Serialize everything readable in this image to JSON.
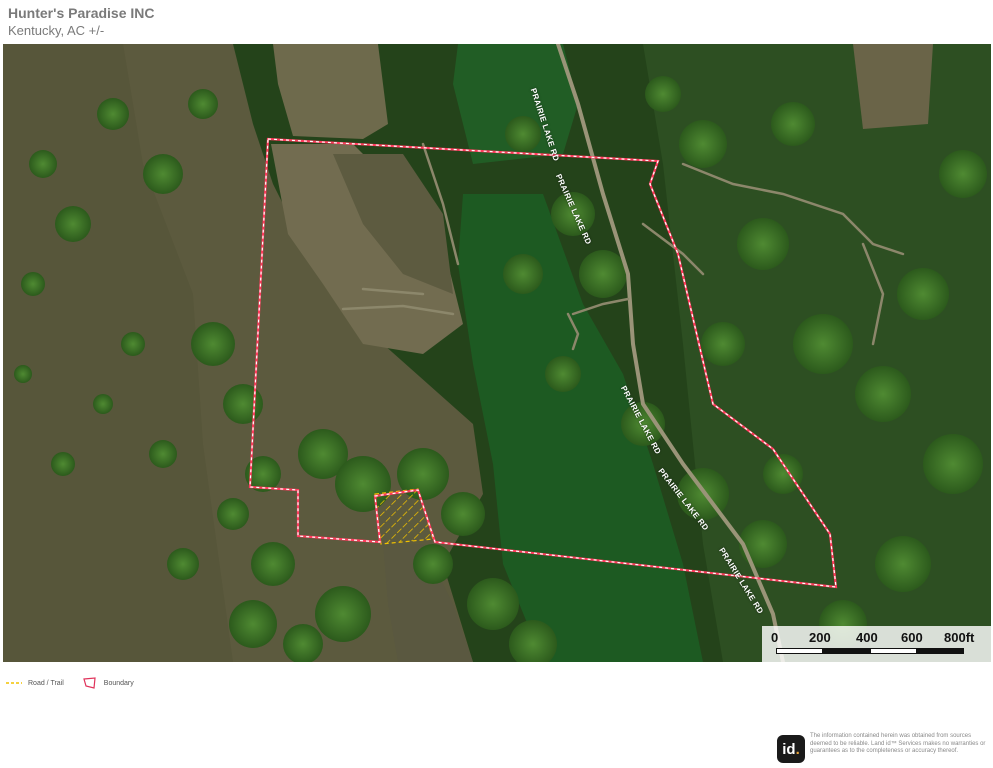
{
  "header": {
    "title": "Hunter's Paradise INC",
    "subtitle": "Kentucky,  AC +/-"
  },
  "map": {
    "road_labels": [
      "PRAIRIE LAKE RD",
      "PRAIRIE LAKE RD",
      "PRAIRIE LAKE RD",
      "PRAIRIE LAKE RD",
      "PRAIRIE LAKE RD"
    ],
    "colors": {
      "boundary": "#ff3b5c",
      "trail": "#f2c200",
      "water": "#5c5a3e",
      "lake": "#1d5a22",
      "forest": "#2e5a1e"
    }
  },
  "scale_bar": {
    "ticks": [
      "0",
      "200",
      "400",
      "600",
      "800ft"
    ]
  },
  "legend": {
    "items": [
      {
        "label": "Road / Trail",
        "icon": "trail-line-icon"
      },
      {
        "label": "Boundary",
        "icon": "boundary-polygon-icon"
      }
    ]
  },
  "footer": {
    "logo_text": "id",
    "disclaimer": "The information contained herein was obtained from sources deemed to be reliable. Land id™ Services makes no warranties or guarantees as to the completeness or accuracy thereof."
  }
}
